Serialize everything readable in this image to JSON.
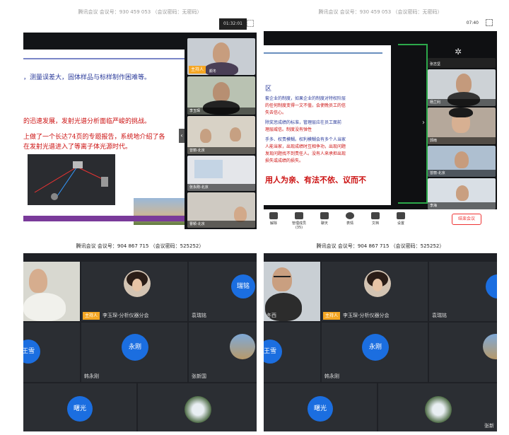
{
  "top_left": {
    "header_blur": "腾讯会议 会议号：930 459 053 （会议密码：无密码）",
    "timer": "01:32:01",
    "slide_lines": [
      "，测量误差大，固体样品与标样制作困难等。",
      "的迅速发展，发射光谱分析面临严峻的挑战。",
      "上做了一个长达74页的专题报告，系统地介绍了各",
      "在发射光谱进入了等离子体光源时代。"
    ],
    "host_tag": "主持人",
    "tiles": [
      {
        "name": "颜冬"
      },
      {
        "name": "李玉琛"
      },
      {
        "name": "曾丽-北京"
      },
      {
        "name": "张永刚-北京"
      },
      {
        "name": "曹颖-北京"
      }
    ]
  },
  "top_right": {
    "header_blur": "腾讯会议 会议号：930 459 053 （会议密码：无密码）",
    "timer": "07:40",
    "slide_lines": [
      "区",
      "套企业的制度，如果企业的制度对特权阶层",
      "的任何制度变得一文不值，会使晚员工的信",
      "失去信心。",
      "除奖惩成绩的标准，管理层应在员工面前",
      "理层威信。制度没有弹性",
      "手多、权责模糊。权利模糊会有多个人当家",
      "人能当家，出现成绩时互相争功，出现问题",
      "发现问题找不到责任人。没有人来承担出现",
      "损失或成绩的损失。"
    ],
    "slide_banner": "用人为亲、有法不依、议而不",
    "tiles": [
      {
        "name": "张志坚"
      },
      {
        "name": "杨兰利"
      },
      {
        "name": "郭雨"
      },
      {
        "name": "曾丽-北京"
      },
      {
        "name": "李海"
      }
    ],
    "toolbar": [
      "解除",
      "管理成员(35)",
      "聊天",
      "表情",
      "文档",
      "设置"
    ],
    "leave_button": "结束会议"
  },
  "bottom_left": {
    "title": "腾讯会议 会议号：904 867 715 （会议密码：525252）",
    "host_tag": "主持人",
    "tiles": [
      {
        "name": "",
        "kind": "video"
      },
      {
        "name": "李玉琛-分析仪器分会",
        "kind": "photo"
      },
      {
        "name": "袁瑞铭",
        "kind": "avatar",
        "avatar": "瑞铭"
      },
      {
        "name": "",
        "kind": "avatar",
        "avatar": "王雪"
      },
      {
        "name": "韩永刚",
        "kind": "avatar",
        "avatar": "永刚"
      },
      {
        "name": "张新国",
        "kind": "photo"
      },
      {
        "name": "",
        "kind": "avatar",
        "avatar": "曙光"
      },
      {
        "name": "",
        "kind": "photo"
      }
    ]
  },
  "bottom_right": {
    "title": "腾讯会议 会议号：904 867 715 （会议密码：525252）",
    "host_tag": "主持人",
    "tiles": [
      {
        "name": "冬西",
        "kind": "video"
      },
      {
        "name": "李玉琛-分析仪器分会",
        "kind": "photo"
      },
      {
        "name": "袁瑞铭",
        "kind": "avatar",
        "avatar": ""
      },
      {
        "name": "",
        "kind": "avatar",
        "avatar": "王雪"
      },
      {
        "name": "韩永刚",
        "kind": "avatar",
        "avatar": "永刚"
      },
      {
        "name": "",
        "kind": "photo"
      },
      {
        "name": "",
        "kind": "avatar",
        "avatar": "曙光"
      },
      {
        "name": "张新",
        "kind": "photo"
      }
    ]
  },
  "colors": {
    "avatar": "#1b6ee0",
    "host": "#f5a623",
    "slide_blue": "#2a3a9a",
    "slide_red": "#cc1111"
  }
}
